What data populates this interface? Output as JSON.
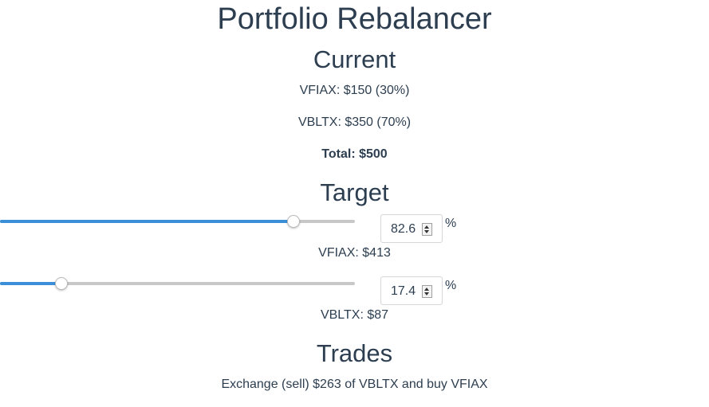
{
  "title": "Portfolio Rebalancer",
  "current": {
    "heading": "Current",
    "vfiax": "VFIAX: $150 (30%)",
    "vbltx": "VBLTX: $350 (70%)",
    "total": "Total: $500"
  },
  "target": {
    "heading": "Target",
    "rows": [
      {
        "value": "82.6",
        "fraction": 0.826,
        "unit": "%",
        "label": "VFIAX: $413"
      },
      {
        "value": "17.4",
        "fraction": 0.174,
        "unit": "%",
        "label": "VBLTX: $87"
      }
    ]
  },
  "trades": {
    "heading": "Trades",
    "text": "Exchange (sell) $263 of VBLTX and buy VFIAX"
  },
  "colors": {
    "slider_fill": "#3b8fd9",
    "slider_track": "#c8c8c8",
    "text": "#2c3e50"
  }
}
